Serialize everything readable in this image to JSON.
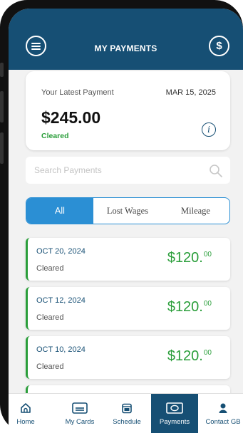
{
  "header": {
    "title": "MY PAYMENTS",
    "right_icon_text": "$"
  },
  "latest": {
    "label": "Your Latest Payment",
    "date": "MAR 15, 2025",
    "amount": "$245.00",
    "status": "Cleared",
    "info_text": "i"
  },
  "search": {
    "placeholder": "Search Payments",
    "value": ""
  },
  "filters": [
    "All",
    "Lost Wages",
    "Mileage"
  ],
  "payments": [
    {
      "date": "OCT 20, 2024",
      "status": "Cleared",
      "amount": "$120.",
      "cents": "00"
    },
    {
      "date": "OCT 12, 2024",
      "status": "Cleared",
      "amount": "$120.",
      "cents": "00"
    },
    {
      "date": "OCT 10, 2024",
      "status": "Cleared",
      "amount": "$120.",
      "cents": "00"
    }
  ],
  "tabs": [
    "Home",
    "My Cards",
    "Schedule",
    "Payments",
    "Contact GB"
  ],
  "colors": {
    "header": "#164f74",
    "accent": "#2b8fd4",
    "success": "#2a9e3a"
  }
}
